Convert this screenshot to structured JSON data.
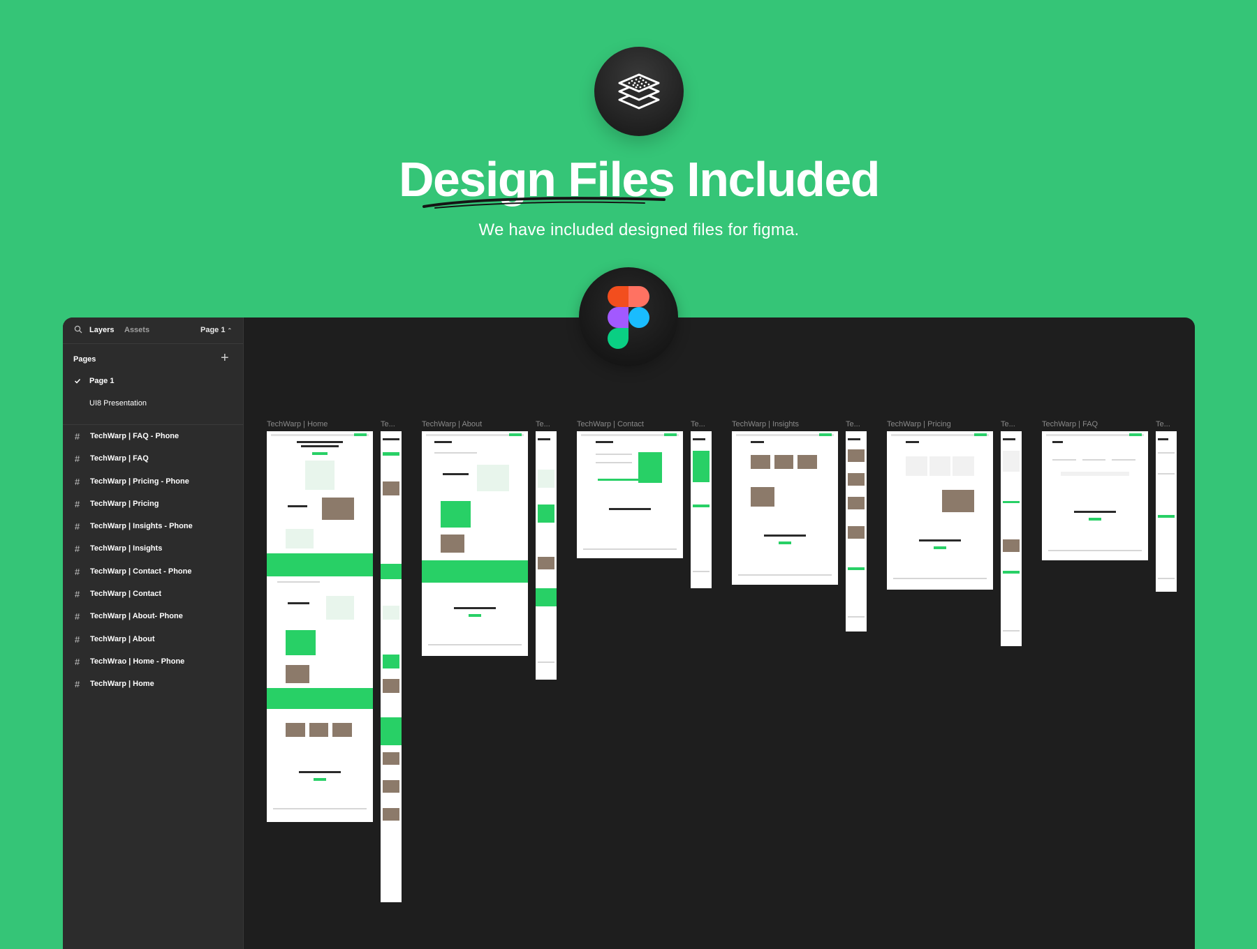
{
  "hero": {
    "icon": "layers-stack-icon",
    "title": "Design Files Included",
    "subtitle": "We have included designed files for figma."
  },
  "figma_logo": "figma-logo",
  "colors": {
    "background": "#35c577",
    "accent": "#28d066",
    "app_bg": "#1e1e1e",
    "sidebar_bg": "#2c2c2c"
  },
  "sidebar": {
    "tabs": {
      "layers": "Layers",
      "assets": "Assets",
      "page_selector": "Page 1"
    },
    "pages_title": "Pages",
    "pages": [
      {
        "label": "Page 1",
        "selected": true
      },
      {
        "label": "UI8 Presentation",
        "selected": false
      }
    ],
    "layers": [
      "TechWarp | FAQ - Phone",
      "TechWarp | FAQ",
      "TechWarp | Pricing - Phone",
      "TechWarp | Pricing",
      "TechWarp | Insights - Phone",
      "TechWarp | Insights",
      "TechWarp | Contact - Phone",
      "TechWarp | Contact",
      "TechWarp | About- Phone",
      "TechWarp | About",
      "TechWrao | Home - Phone",
      "TechWarp | Home"
    ]
  },
  "canvas": {
    "frames": [
      {
        "label": "TechWarp | Home"
      },
      {
        "label": "Te..."
      },
      {
        "label": "TechWarp | About"
      },
      {
        "label": "Te..."
      },
      {
        "label": "TechWarp | Contact"
      },
      {
        "label": "Te..."
      },
      {
        "label": "TechWarp | Insights"
      },
      {
        "label": "Te..."
      },
      {
        "label": "TechWarp | Pricing"
      },
      {
        "label": "Te..."
      },
      {
        "label": "TechWarp | FAQ"
      },
      {
        "label": "Te..."
      }
    ]
  }
}
